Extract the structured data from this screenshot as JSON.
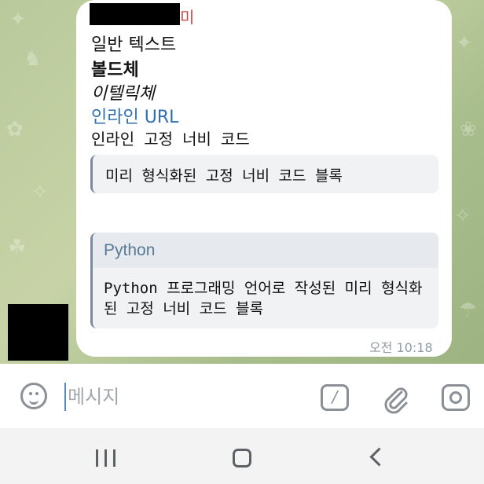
{
  "message": {
    "sender_suffix": "미",
    "lines": {
      "plain": "일반 텍스트",
      "bold": "볼드체",
      "italic": "이텔릭체",
      "link": "인라인 URL",
      "inline_code": "인라인 고정 너비 코드"
    },
    "pre_block": "미리 형식화된 고정 너비 코드 블록",
    "code_block": {
      "language": "Python",
      "code": "Python 프로그래밍 언어로 작성된 미리 형식화된 고정 너비 코드 블록"
    },
    "time": "오전 10:18"
  },
  "input": {
    "placeholder": "메시지"
  },
  "icons": {
    "emoji": "smile-icon",
    "commands": "slash-command-icon",
    "attach": "paperclip-icon",
    "camera": "camera-icon"
  },
  "colors": {
    "link": "#2f6fb1",
    "sender": "#d04545",
    "chat_background": "#b9c99b"
  }
}
